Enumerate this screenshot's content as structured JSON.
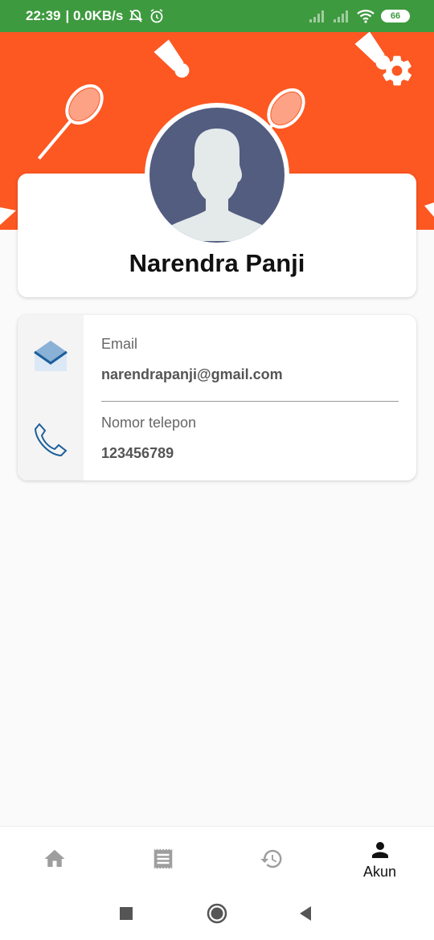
{
  "status_bar": {
    "time": "22:39",
    "network_speed": "| 0.0KB/s",
    "battery": "66"
  },
  "profile": {
    "name": "Narendra Panji"
  },
  "contact": {
    "email_label": "Email",
    "email_value": "narendrapanji@gmail.com",
    "phone_label": "Nomor telepon",
    "phone_value": "123456789"
  },
  "bottom_nav": {
    "items": [
      {
        "icon": "home-icon",
        "label": ""
      },
      {
        "icon": "receipt-icon",
        "label": ""
      },
      {
        "icon": "history-icon",
        "label": ""
      },
      {
        "icon": "person-icon",
        "label": "Akun",
        "active": true
      }
    ]
  },
  "colors": {
    "status_bar": "#3e9a3f",
    "banner": "#fd5722",
    "avatar_bg": "#525d80"
  }
}
